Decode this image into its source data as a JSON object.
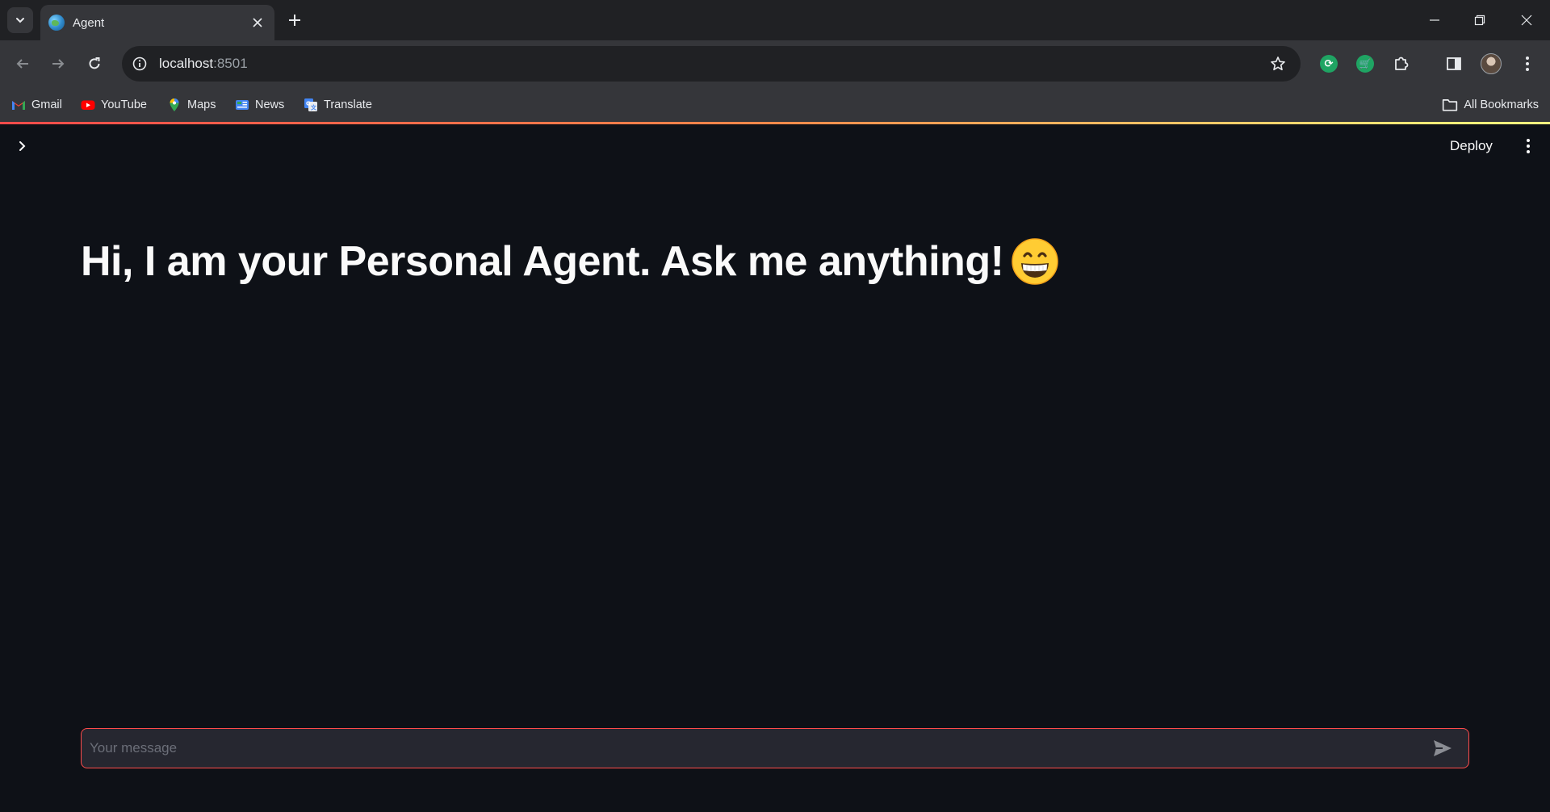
{
  "browser": {
    "tab": {
      "title": "Agent"
    },
    "omnibox": {
      "host": "localhost",
      "port": ":8501"
    },
    "bookmarks": [
      {
        "label": "Gmail"
      },
      {
        "label": "YouTube"
      },
      {
        "label": "Maps"
      },
      {
        "label": "News"
      },
      {
        "label": "Translate"
      }
    ],
    "all_bookmarks_label": "All Bookmarks"
  },
  "app": {
    "deploy_label": "Deploy",
    "headline": "Hi, I am your Personal Agent. Ask me anything!",
    "chat": {
      "placeholder": "Your message"
    }
  },
  "colors": {
    "app_bg": "#0e1117",
    "accent": "#ff4b4b",
    "input_bg": "#262730"
  }
}
